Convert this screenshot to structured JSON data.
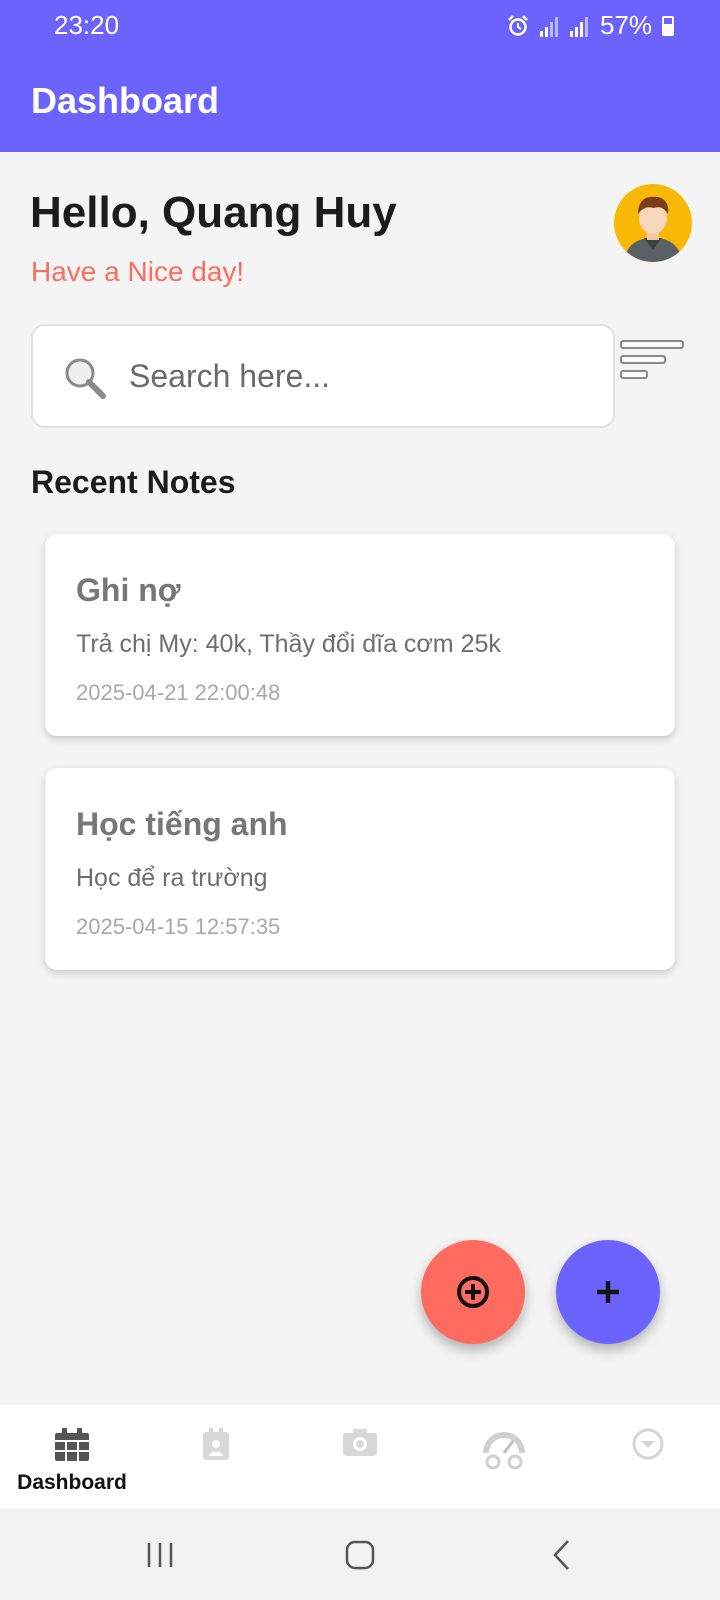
{
  "status_bar": {
    "time": "23:20",
    "battery": "57%",
    "icons": [
      "alarm-icon",
      "signal-icon",
      "signal-icon",
      "battery-icon"
    ]
  },
  "app_bar": {
    "title": "Dashboard"
  },
  "header": {
    "greeting": "Hello, Quang Huy",
    "subtitle": "Have a Nice day!"
  },
  "search": {
    "placeholder": "Search here...",
    "value": ""
  },
  "recent_notes": {
    "title": "Recent Notes",
    "notes": [
      {
        "title": "Ghi nợ",
        "body": "Trả chị My: 40k, Thầy đổi dĩa cơm 25k",
        "date": "2025-04-21 22:00:48"
      },
      {
        "title": "Học tiếng anh",
        "body": "Học để ra trường",
        "date": "2025-04-15 12:57:35"
      }
    ]
  },
  "bottom_nav": {
    "active": "Dashboard",
    "items": [
      {
        "label": "Dashboard",
        "icon": "calendar-grid-icon"
      },
      {
        "label": "",
        "icon": "contacts-calendar-icon"
      },
      {
        "label": "",
        "icon": "camera-icon"
      },
      {
        "label": "",
        "icon": "gauge-icon"
      },
      {
        "label": "",
        "icon": "chevron-down-circle-icon"
      }
    ]
  },
  "colors": {
    "primary": "#6c63ff",
    "accent": "#ff6b5e",
    "background": "#f4f4f4"
  }
}
